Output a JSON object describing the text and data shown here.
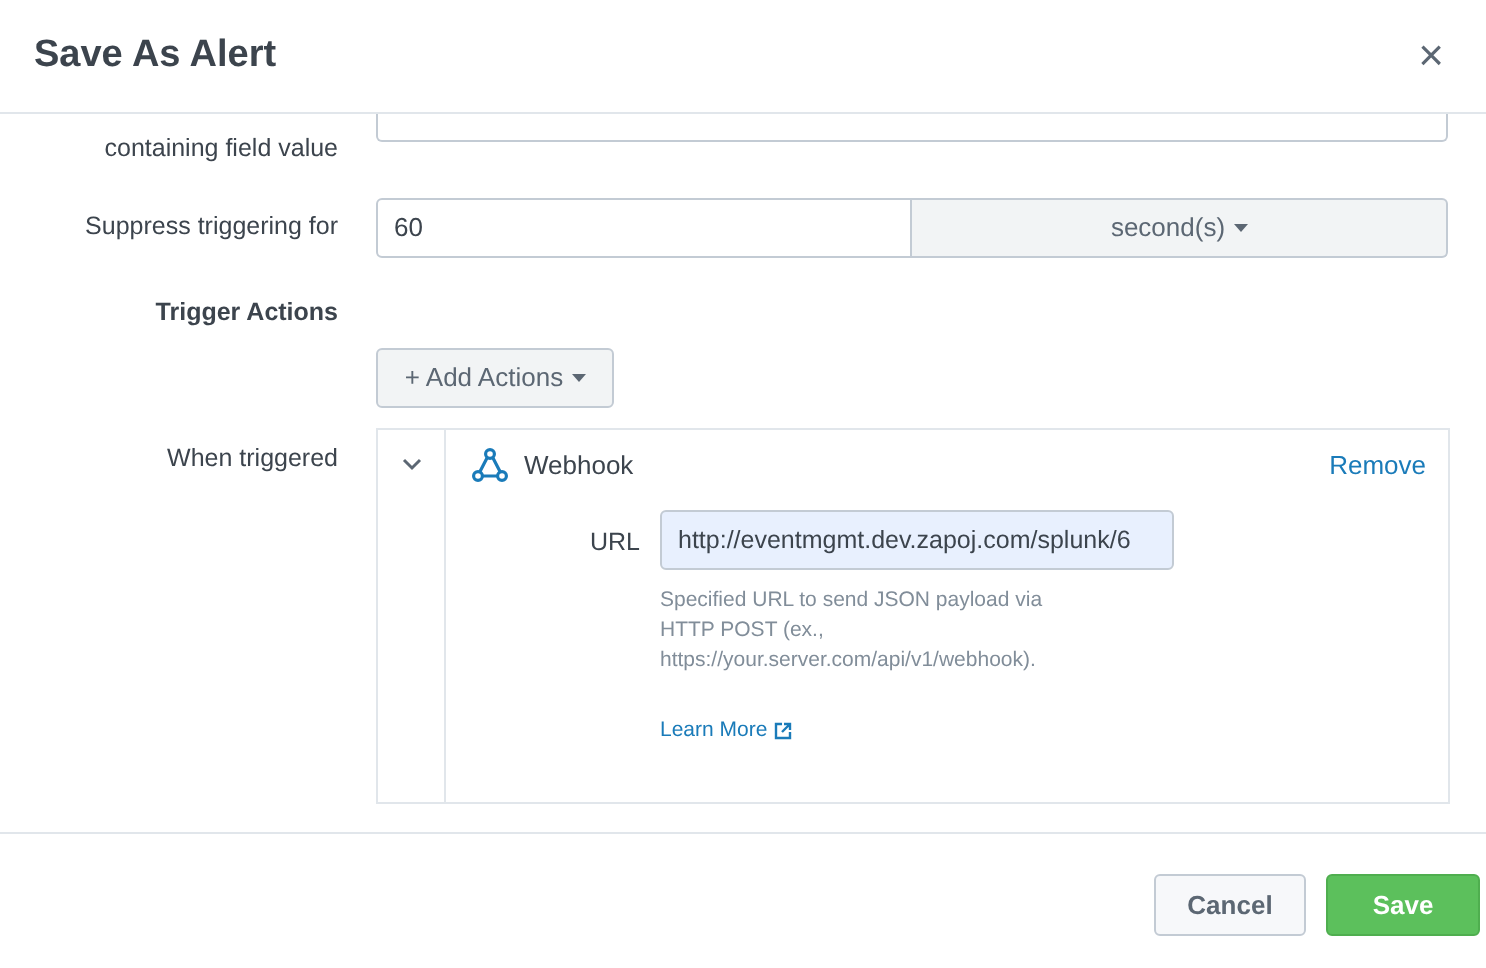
{
  "dialog": {
    "title": "Save As Alert",
    "close": "×"
  },
  "fields": [
    {
      "label": "containing field value"
    },
    {
      "label": "Suppress triggering for",
      "value": "60",
      "unit": "second(s)"
    }
  ],
  "trigger_actions": {
    "heading": "Trigger Actions",
    "add_button": "+ Add Actions",
    "when_label": "When triggered",
    "action": {
      "name": "Webhook",
      "expanded": true,
      "remove": "Remove",
      "url_label": "URL",
      "url": "http://eventmgmt.dev.zapoj.com/splunk/6",
      "help": "Specified URL to send JSON payload via HTTP POST (ex., https://your.server.com/api/v1/webhook).",
      "learn_more": "Learn More"
    }
  },
  "buttons": [
    {
      "label": "Cancel",
      "kind": "secondary"
    },
    {
      "label": "Save",
      "kind": "primary"
    }
  ]
}
